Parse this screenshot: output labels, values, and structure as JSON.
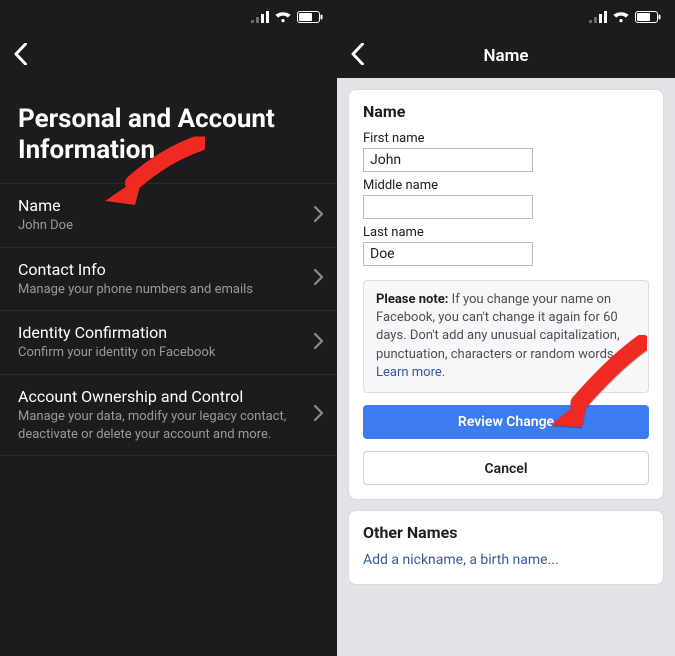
{
  "left": {
    "page_title": "Personal and Account Information",
    "items": [
      {
        "title": "Name",
        "sub": "John Doe"
      },
      {
        "title": "Contact Info",
        "sub": "Manage your phone numbers and emails"
      },
      {
        "title": "Identity Confirmation",
        "sub": "Confirm your identity on Facebook"
      },
      {
        "title": "Account Ownership and Control",
        "sub": "Manage your data, modify your legacy contact, deactivate or delete your account and more."
      }
    ]
  },
  "right": {
    "nav_title": "Name",
    "section_title": "Name",
    "first_label": "First name",
    "first_value": "John",
    "middle_label": "Middle name",
    "middle_value": "",
    "last_label": "Last name",
    "last_value": "Doe",
    "note_bold": "Please note:",
    "note_text": " If you change your name on Facebook, you can't change it again for 60 days. Don't add any unusual capitalization, punctuation, characters or random words. ",
    "note_learn": "Learn more",
    "review_label": "Review Change",
    "cancel_label": "Cancel",
    "other_names_title": "Other Names",
    "add_nick_label": "Add a nickname, a birth name..."
  }
}
